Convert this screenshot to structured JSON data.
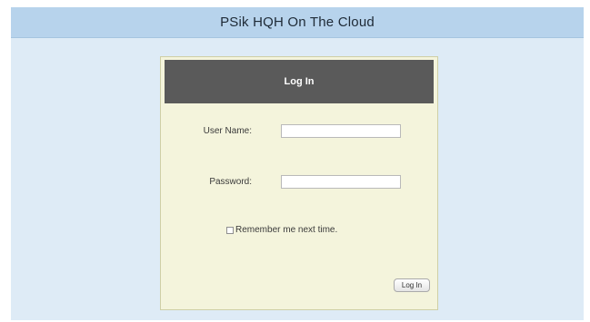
{
  "header": {
    "title": "PSik HQH On The Cloud"
  },
  "login_form": {
    "title": "Log In",
    "username": {
      "label": "User Name:",
      "value": ""
    },
    "password": {
      "label": "Password:",
      "value": ""
    },
    "remember_me": {
      "label": "Remember me next time.",
      "checked": false
    },
    "submit_label": "Log In"
  },
  "colors": {
    "page_background": "#deebf6",
    "header_background": "#b7d3ec",
    "panel_background": "#f4f4dc",
    "panel_header_background": "#5a5a5a"
  }
}
